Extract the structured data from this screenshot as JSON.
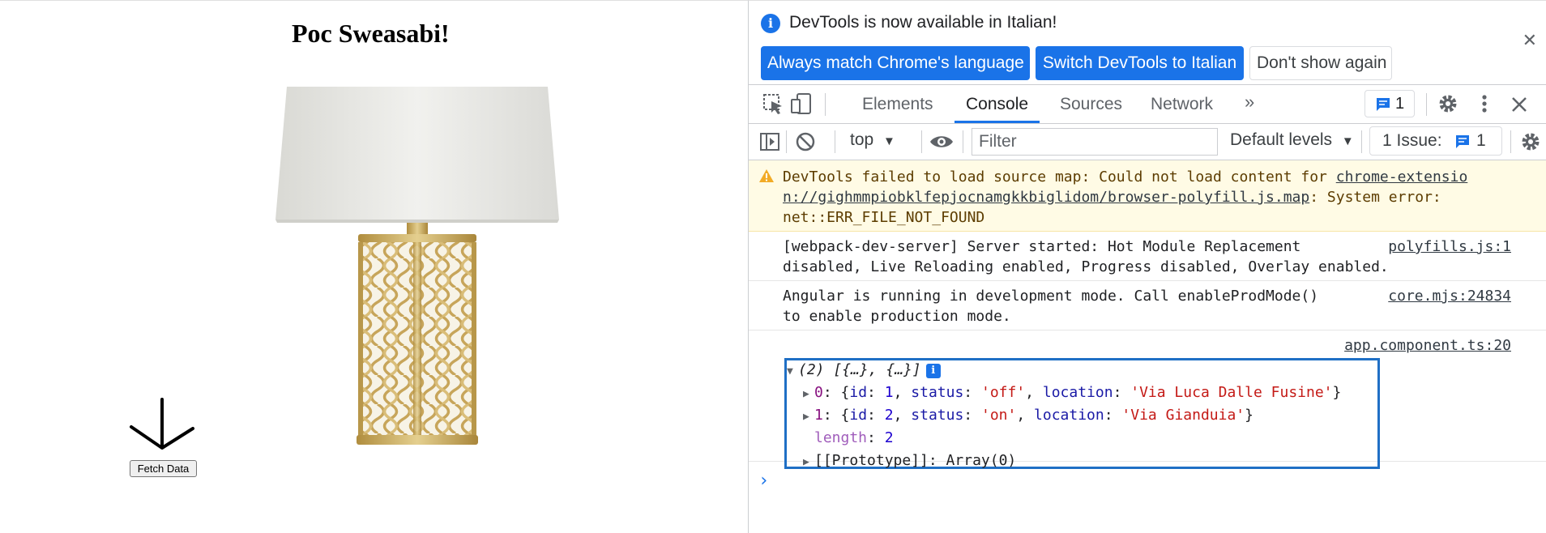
{
  "page": {
    "title": "Poc Sweasabi!",
    "fetch_button": "Fetch Data"
  },
  "devtools": {
    "infobar": {
      "message": "DevTools is now available in Italian!",
      "btn_match": "Always match Chrome's language",
      "btn_switch": "Switch DevTools to Italian",
      "btn_dismiss": "Don't show again"
    },
    "tabs": [
      "Elements",
      "Console",
      "Sources",
      "Network"
    ],
    "active_tab": "Console",
    "message_count": "1",
    "console_bar": {
      "context": "top",
      "filter_placeholder": "Filter",
      "levels": "Default levels",
      "issues_label": "1 Issue:",
      "issues_count": "1"
    },
    "messages": {
      "warning": {
        "text_prefix": "DevTools failed to load source map: Could not load content for ",
        "link1": "chrome-extensio",
        "link2": "n://gighmmpiobklfepjocnamgkkbiglidom/browser-polyfill.js.map",
        "text_suffix": ": System error:",
        "line3": "net::ERR_FILE_NOT_FOUND"
      },
      "webpack": {
        "line1": "[webpack-dev-server] Server started: Hot Module Replacement",
        "line2": "disabled, Live Reloading enabled, Progress disabled, Overlay enabled.",
        "source": "polyfills.js:1"
      },
      "angular": {
        "line1": "Angular is running in development mode. Call enableProdMode()",
        "line2": "to enable production mode.",
        "source": "core.mjs:24834"
      },
      "array_log": {
        "source": "app.component.ts:20",
        "summary": "(2) [{…}, {…}]",
        "items": [
          {
            "index": "0",
            "id": "1",
            "status": "'off'",
            "location": "'Via Luca Dalle Fusine'"
          },
          {
            "index": "1",
            "id": "2",
            "status": "'on'",
            "location": "'Via Gianduia'"
          }
        ],
        "length_key": "length",
        "length_value": "2",
        "prototype": "[[Prototype]]: Array(0)"
      }
    },
    "colors": {
      "accent": "#1a73e8",
      "warning_bg": "#fffbe5",
      "highlight_border": "#1f6fc5"
    }
  }
}
